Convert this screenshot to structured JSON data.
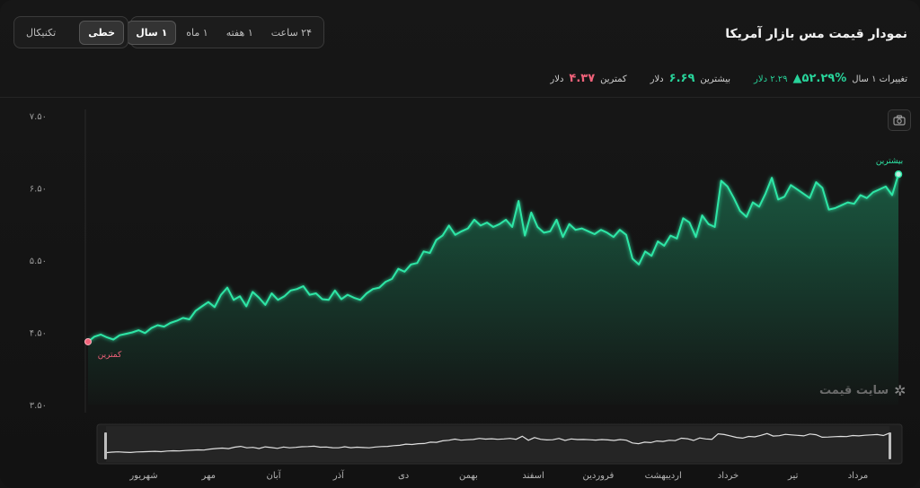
{
  "header": {
    "title": "نمودار قیمت مس بازار آمریکا",
    "range_tabs": [
      "۲۴ ساعت",
      "۱ هفته",
      "۱ ماه",
      "۱ سال"
    ],
    "range_active": 3,
    "type_tabs": [
      "خطی",
      "تکنیکال"
    ],
    "type_active": 0
  },
  "stats": {
    "change_label": "تغییرات ۱ سال",
    "change_pct": "۵۲.۲۹%▲",
    "change_abs": "۲.۲۹ دلار",
    "max_label": "بیشترین",
    "max_value": "۶.۶۹",
    "max_unit": "دلار",
    "min_label": "کمترین",
    "min_value": "۴.۳۷",
    "min_unit": "دلار"
  },
  "watermark": {
    "text": "سایت قیمت",
    "icon": "snowflake-icon"
  },
  "camera_icon": "camera-icon",
  "colors": {
    "line": "#2ee6a6",
    "high": "#2ee6a6",
    "low": "#f0627a",
    "nav_line": "#e0e0e0"
  },
  "chart_data": {
    "type": "area",
    "title": "نمودار قیمت مس بازار آمریکا",
    "xlabel": "",
    "ylabel": "",
    "ylim": [
      3.5,
      7.5
    ],
    "y_ticks": [
      "۷.۵۰",
      "۶.۵۰",
      "۵.۵۰",
      "۴.۵۰",
      "۳.۵۰"
    ],
    "y_tick_values": [
      7.5,
      6.5,
      5.5,
      4.5,
      3.5
    ],
    "x_tick_labels": [
      "شهریور",
      "مهر",
      "آبان",
      "آذر",
      "دی",
      "بهمن",
      "اسفند",
      "فروردین",
      "اردیبهشت",
      "خرداد",
      "تیر",
      "مرداد"
    ],
    "high_label": "بیشترین",
    "low_label": "کمترین",
    "grid": false,
    "series": [
      {
        "values": [
          4.37,
          4.44,
          4.47,
          4.43,
          4.4,
          4.46,
          4.48,
          4.5,
          4.53,
          4.49,
          4.56,
          4.6,
          4.58,
          4.63,
          4.66,
          4.7,
          4.68,
          4.8,
          4.86,
          4.92,
          4.85,
          5.02,
          5.12,
          4.95,
          5.0,
          4.86,
          5.06,
          4.98,
          4.88,
          5.04,
          4.95,
          5.0,
          5.08,
          5.1,
          5.14,
          5.02,
          5.04,
          4.96,
          4.95,
          5.08,
          4.96,
          5.02,
          4.98,
          4.95,
          5.04,
          5.1,
          5.12,
          5.2,
          5.24,
          5.38,
          5.34,
          5.44,
          5.46,
          5.62,
          5.6,
          5.78,
          5.84,
          5.98,
          5.85,
          5.9,
          5.94,
          6.06,
          5.98,
          6.02,
          5.96,
          6.0,
          6.06,
          5.96,
          6.32,
          5.84,
          6.16,
          5.96,
          5.88,
          5.9,
          6.06,
          5.82,
          6.0,
          5.92,
          5.94,
          5.9,
          5.86,
          5.92,
          5.88,
          5.82,
          5.92,
          5.85,
          5.52,
          5.44,
          5.62,
          5.56,
          5.76,
          5.7,
          5.84,
          5.8,
          6.08,
          6.02,
          5.82,
          6.12,
          6.0,
          5.96,
          6.6,
          6.52,
          6.36,
          6.18,
          6.1,
          6.3,
          6.24,
          6.42,
          6.64,
          6.34,
          6.38,
          6.54,
          6.48,
          6.42,
          6.36,
          6.58,
          6.5,
          6.2,
          6.22,
          6.26,
          6.3,
          6.28,
          6.4,
          6.36,
          6.44,
          6.48,
          6.52,
          6.4,
          6.69
        ]
      }
    ]
  }
}
